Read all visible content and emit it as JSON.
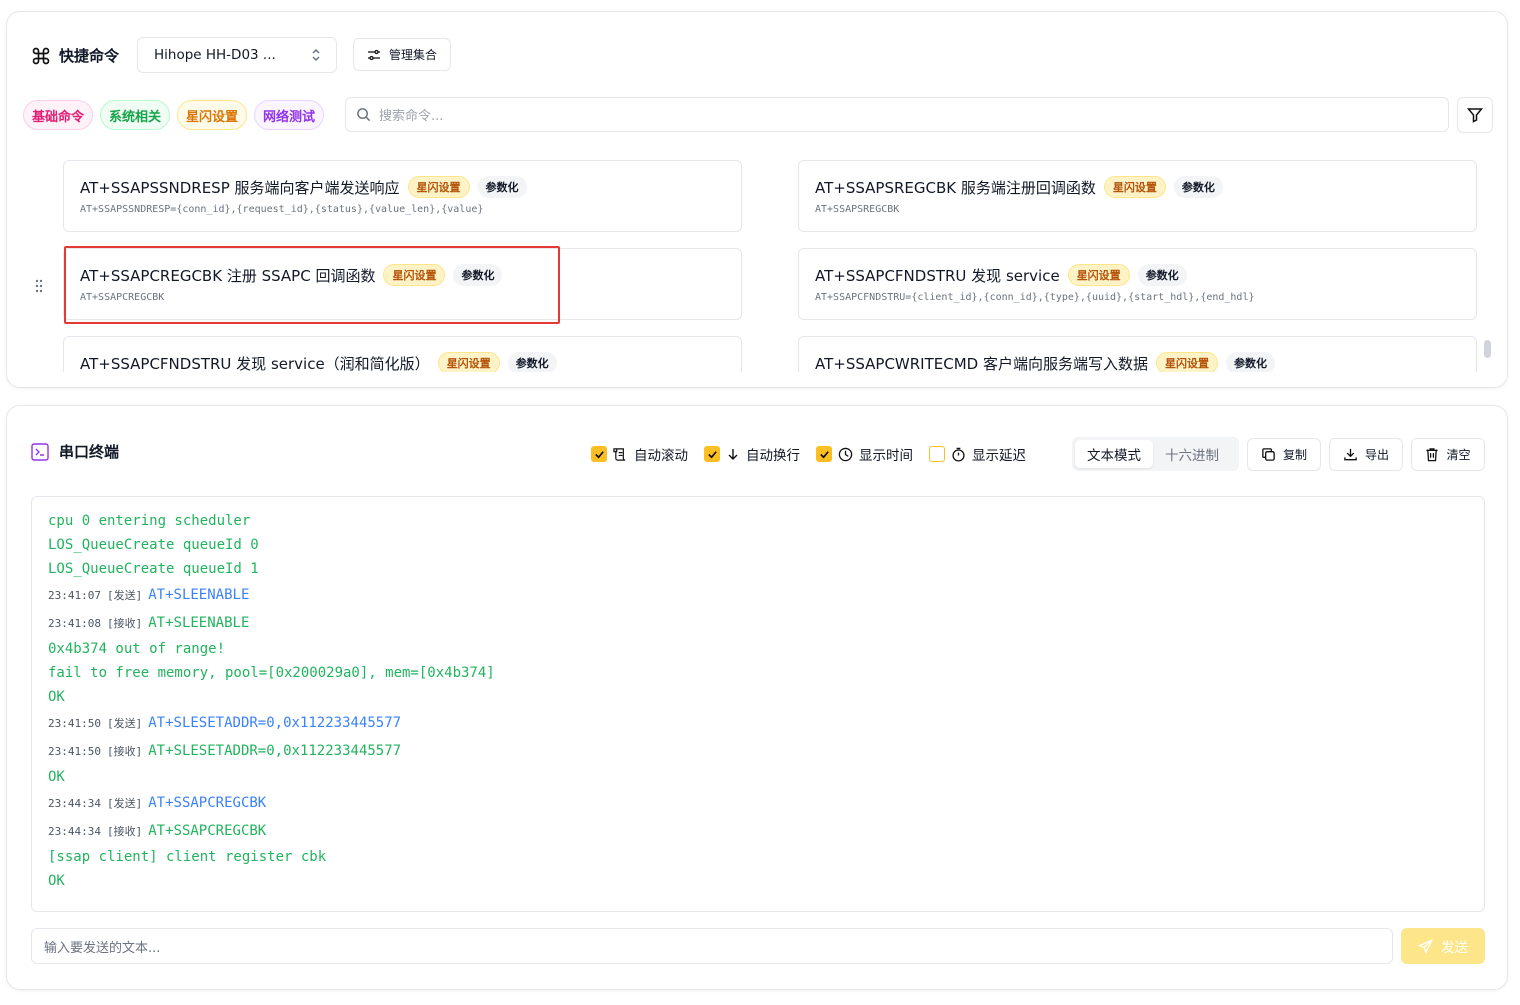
{
  "commands": {
    "title": "快捷命令",
    "device_select": "Hihope HH-D03 ...",
    "manage_label": "管理集合",
    "tags": [
      {
        "label": "基础命令",
        "color": "#e11d74",
        "bg": "#fdf2f8",
        "border": "#fbcfe8"
      },
      {
        "label": "系统相关",
        "color": "#16a34a",
        "bg": "#f0fdf4",
        "border": "#bbf7d0"
      },
      {
        "label": "星闪设置",
        "color": "#d97706",
        "bg": "#fffbeb",
        "border": "#fde68a"
      },
      {
        "label": "网络测试",
        "color": "#9333ea",
        "bg": "#faf5ff",
        "border": "#e9d5ff"
      }
    ],
    "search_placeholder": "搜索命令...",
    "cards": [
      {
        "title": "AT+SSAPSSNDRESP 服务端向客户端发送响应",
        "badge": "星闪设置",
        "param": "参数化",
        "sub": "AT+SSAPSSNDRESP={conn_id},{request_id},{status},{value_len},{value}"
      },
      {
        "title": "AT+SSAPSREGCBK 服务端注册回调函数",
        "badge": "星闪设置",
        "param": "参数化",
        "sub": "AT+SSAPSREGCBK"
      },
      {
        "title": "AT+SSAPCREGCBK 注册 SSAPC 回调函数",
        "badge": "星闪设置",
        "param": "参数化",
        "sub": "AT+SSAPCREGCBK"
      },
      {
        "title": "AT+SSAPCFNDSTRU 发现 service",
        "badge": "星闪设置",
        "param": "参数化",
        "sub": "AT+SSAPCFNDSTRU={client_id},{conn_id},{type},{uuid},{start_hdl},{end_hdl}"
      },
      {
        "title": "AT+SSAPCFNDSTRU 发现 service（润和简化版）",
        "badge": "星闪设置",
        "param": "参数化",
        "sub": ""
      },
      {
        "title": "AT+SSAPCWRITECMD 客户端向服务端写入数据",
        "badge": "星闪设置",
        "param": "参数化",
        "sub": ""
      }
    ]
  },
  "terminal": {
    "title": "串口终端",
    "options": [
      {
        "label": "自动滚动",
        "checked": true,
        "icon": "scroll-icon"
      },
      {
        "label": "自动换行",
        "checked": true,
        "icon": "arrow-down-icon"
      },
      {
        "label": "显示时间",
        "checked": true,
        "icon": "clock-icon"
      },
      {
        "label": "显示延迟",
        "checked": false,
        "icon": "timer-icon"
      }
    ],
    "modes": [
      "文本模式",
      "十六进制"
    ],
    "active_mode": "文本模式",
    "copy_label": "复制",
    "export_label": "导出",
    "clear_label": "清空",
    "lines": [
      {
        "text": "cpu 0 entering scheduler"
      },
      {
        "text": "LOS_QueueCreate queueId 0"
      },
      {
        "text": "LOS_QueueCreate queueId 1"
      },
      {
        "ts": "23:41:07",
        "dir": "[发送]",
        "kind": "send",
        "text": "AT+SLEENABLE"
      },
      {
        "ts": "23:41:08",
        "dir": "[接收]",
        "kind": "recv",
        "text": "AT+SLEENABLE"
      },
      {
        "text": "0x4b374 out of range!"
      },
      {
        "text": "fail to free memory, pool=[0x200029a0], mem=[0x4b374]"
      },
      {
        "text": "OK"
      },
      {
        "ts": "23:41:50",
        "dir": "[发送]",
        "kind": "send",
        "text": "AT+SLESETADDR=0,0x112233445577"
      },
      {
        "ts": "23:41:50",
        "dir": "[接收]",
        "kind": "recv",
        "text": "AT+SLESETADDR=0,0x112233445577"
      },
      {
        "text": "OK"
      },
      {
        "ts": "23:44:34",
        "dir": "[发送]",
        "kind": "send",
        "text": "AT+SSAPCREGCBK"
      },
      {
        "ts": "23:44:34",
        "dir": "[接收]",
        "kind": "recv",
        "text": "AT+SSAPCREGCBK"
      },
      {
        "text": "[ssap client] client register cbk"
      },
      {
        "text": "OK"
      }
    ],
    "input_placeholder": "输入要发送的文本...",
    "send_label": "发送"
  }
}
